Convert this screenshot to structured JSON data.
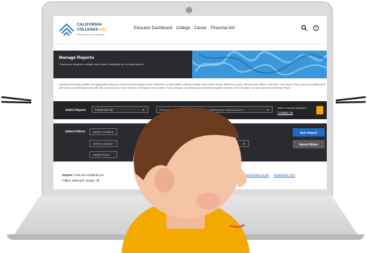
{
  "logo": {
    "line1": "CALIFORNIA",
    "line2": "COLLEGES",
    "line2_suffix": ".edu",
    "tagline": "DISCOVER YOUR JOURNEY"
  },
  "nav": {
    "links": [
      "Educator Dashboard",
      "College",
      "Career",
      "Financial Aid"
    ]
  },
  "hero": {
    "title": "Manage Reports",
    "subtitle": "Track your student's college and career readiness by running reports."
  },
  "intro": "Quickly and easily obtain the aggregate data you need to better support your students on their path to being college and career ready. Select a report, choose your filters, and then, run report. View report summary and drill down on individual links with the summary for more details. Drill down even further, if you choose, by clicking on individual student names in the Student List tab and view their My Plans.",
  "report_bar": {
    "label": "Select Report:",
    "report_value": "Financial Aid",
    "question_value": "How are students progressing toward completing the financial aid re",
    "help_text": "Have a report question?",
    "contact_link": "Contact Us"
  },
  "filters": {
    "label": "Select Filters:",
    "grade_placeholder": "Select Grade",
    "gender_placeholder": "Select Gender",
    "race_placeholder": "Select Race",
    "run_button": "Run Report",
    "reset_button": "Reset Filters"
  },
  "report_summary": {
    "report_prefix": "Report:",
    "report_text": "How are students pro",
    "filters_text": "Filters Selected: Grade: All",
    "download_xlsx": "Download XLSX",
    "download_csv": "Download CSV"
  },
  "colors": {
    "brand_navy": "#1b3e6f",
    "accent_blue": "#1f6bc4",
    "hero_blue": "#3a97d9",
    "panel_dark": "#242428",
    "accent_gold": "#f2a900"
  }
}
